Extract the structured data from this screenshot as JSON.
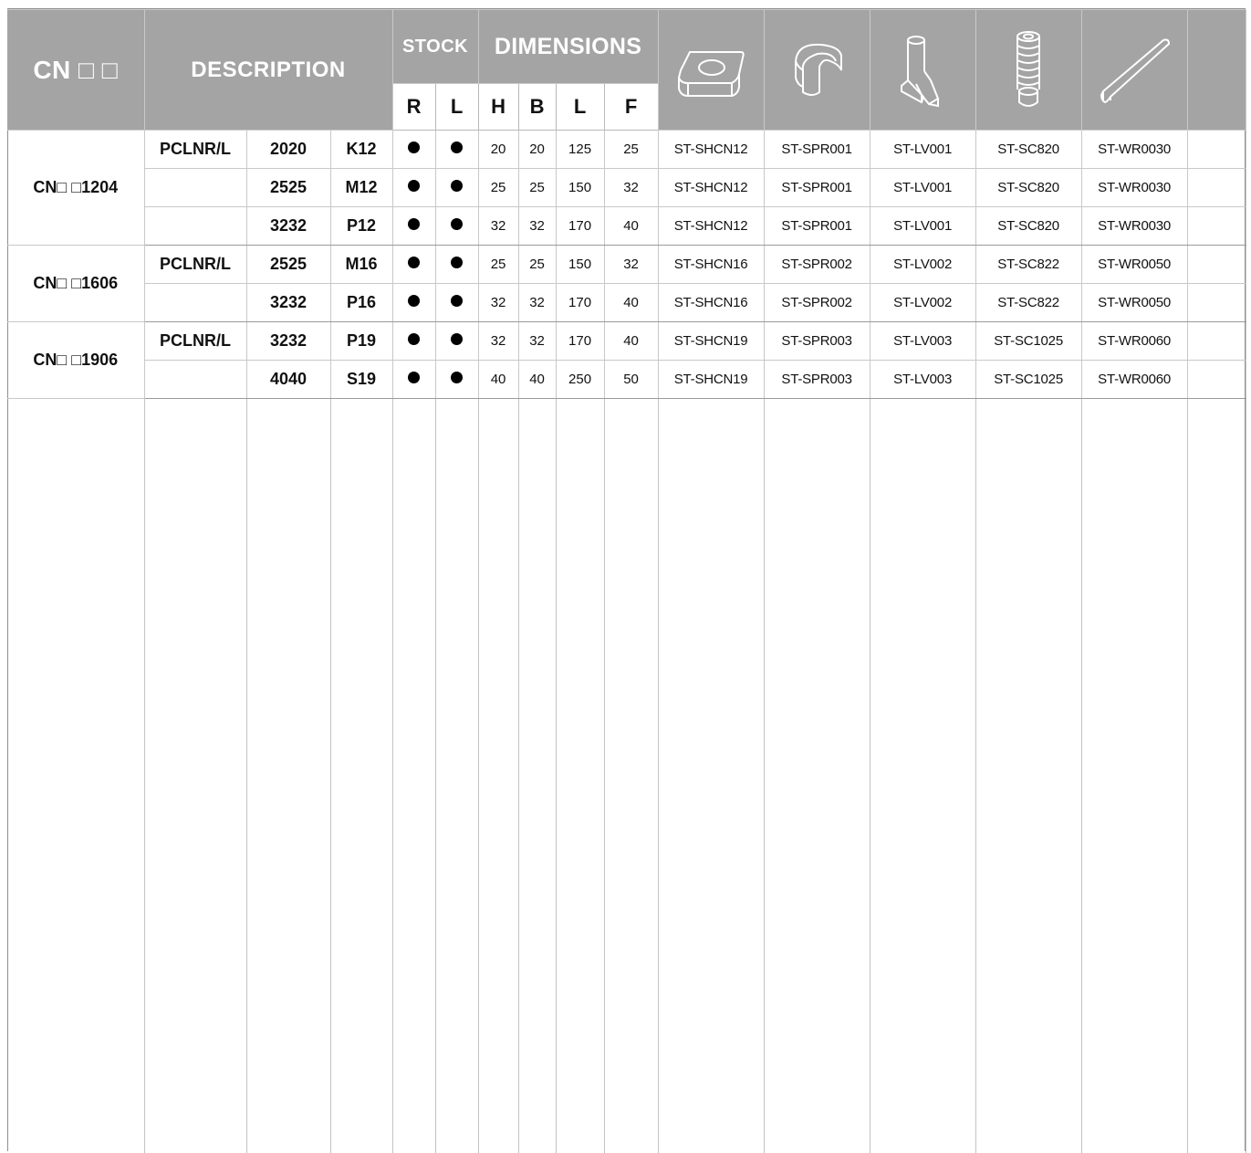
{
  "header": {
    "series_title": "CN □ □",
    "description": "DESCRIPTION",
    "stock": "STOCK",
    "dimensions": "DIMENSIONS",
    "stock_cols": [
      "R",
      "L"
    ],
    "dim_cols": [
      "H",
      "B",
      "L",
      "F"
    ],
    "part_icons": [
      "insert-shim-icon",
      "spring-clip-icon",
      "lever-icon",
      "screw-icon",
      "wrench-icon"
    ]
  },
  "groups": [
    {
      "name": "CN□ □1204",
      "rows": [
        {
          "type": "PCLNR/L",
          "size": "2020",
          "code": "K12",
          "r": "●",
          "l": "●",
          "h": "20",
          "b": "20",
          "len": "125",
          "f": "25",
          "p1": "ST-SHCN12",
          "p2": "ST-SPR001",
          "p3": "ST-LV001",
          "p4": "ST-SC820",
          "p5": "ST-WR0030"
        },
        {
          "type": "",
          "size": "2525",
          "code": "M12",
          "r": "●",
          "l": "●",
          "h": "25",
          "b": "25",
          "len": "150",
          "f": "32",
          "p1": "ST-SHCN12",
          "p2": "ST-SPR001",
          "p3": "ST-LV001",
          "p4": "ST-SC820",
          "p5": "ST-WR0030"
        },
        {
          "type": "",
          "size": "3232",
          "code": "P12",
          "r": "●",
          "l": "●",
          "h": "32",
          "b": "32",
          "len": "170",
          "f": "40",
          "p1": "ST-SHCN12",
          "p2": "ST-SPR001",
          "p3": "ST-LV001",
          "p4": "ST-SC820",
          "p5": "ST-WR0030"
        }
      ]
    },
    {
      "name": "CN□ □1606",
      "rows": [
        {
          "type": "PCLNR/L",
          "size": "2525",
          "code": "M16",
          "r": "●",
          "l": "●",
          "h": "25",
          "b": "25",
          "len": "150",
          "f": "32",
          "p1": "ST-SHCN16",
          "p2": "ST-SPR002",
          "p3": "ST-LV002",
          "p4": "ST-SC822",
          "p5": "ST-WR0050"
        },
        {
          "type": "",
          "size": "3232",
          "code": "P16",
          "r": "●",
          "l": "●",
          "h": "32",
          "b": "32",
          "len": "170",
          "f": "40",
          "p1": "ST-SHCN16",
          "p2": "ST-SPR002",
          "p3": "ST-LV002",
          "p4": "ST-SC822",
          "p5": "ST-WR0050"
        }
      ]
    },
    {
      "name": "CN□ □1906",
      "rows": [
        {
          "type": "PCLNR/L",
          "size": "3232",
          "code": "P19",
          "r": "●",
          "l": "●",
          "h": "32",
          "b": "32",
          "len": "170",
          "f": "40",
          "p1": "ST-SHCN19",
          "p2": "ST-SPR003",
          "p3": "ST-LV003",
          "p4": "ST-SC1025",
          "p5": "ST-WR0060"
        },
        {
          "type": "",
          "size": "4040",
          "code": "S19",
          "r": "●",
          "l": "●",
          "h": "40",
          "b": "40",
          "len": "250",
          "f": "50",
          "p1": "ST-SHCN19",
          "p2": "ST-SPR003",
          "p3": "ST-LV003",
          "p4": "ST-SC1025",
          "p5": "ST-WR0060"
        }
      ]
    }
  ]
}
